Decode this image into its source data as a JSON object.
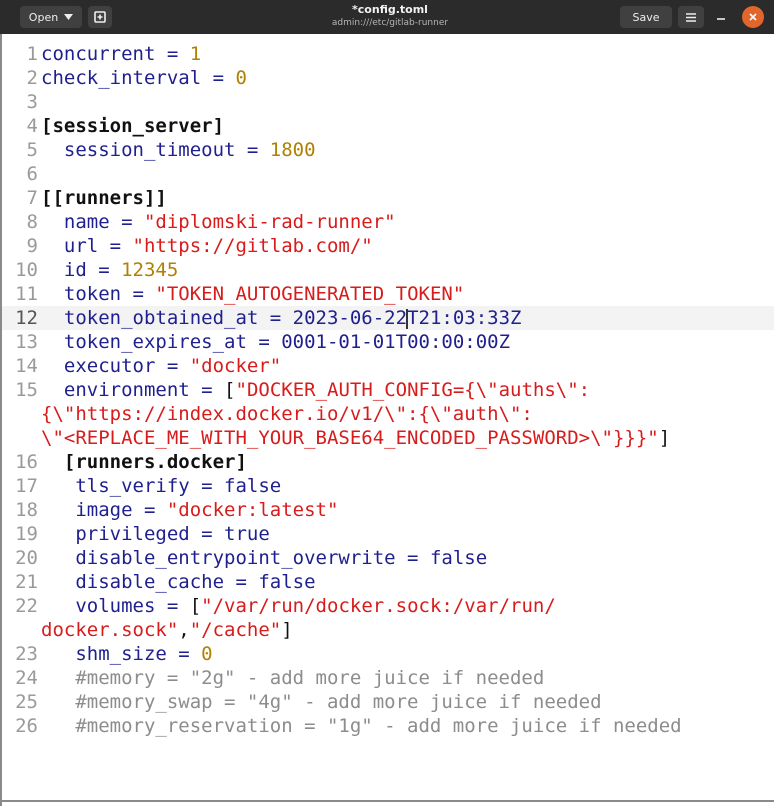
{
  "header": {
    "open_label": "Open",
    "title": "*config.toml",
    "subtitle": "admin:///etc/gitlab-runner",
    "save_label": "Save",
    "icons": [
      "chevron-down-icon",
      "new-document-icon",
      "hamburger-menu-icon",
      "minimize-icon",
      "close-icon"
    ],
    "accent_color": "#e0662c"
  },
  "editor": {
    "current_line": 12,
    "colors": {
      "key": "#1f1f8f",
      "number": "#b08000",
      "string": "#d81b1b",
      "comment": "#8c8c8c",
      "line_number": "#9a9a9a"
    },
    "lines": [
      {
        "n": "1",
        "k": "concurrent",
        "op": " = ",
        "v": "1"
      },
      {
        "n": "2",
        "k": "check_interval",
        "op": " = ",
        "v": "0"
      },
      {
        "n": "3"
      },
      {
        "n": "4",
        "sec": "[session_server]"
      },
      {
        "n": "5",
        "k": "  session_timeout",
        "op": " = ",
        "v": "1800"
      },
      {
        "n": "6"
      },
      {
        "n": "7",
        "sec": "[[runners]]"
      },
      {
        "n": "8",
        "k": "  name",
        "op": " = ",
        "v": "\"diplomski-rad-runner\""
      },
      {
        "n": "9",
        "k": "  url",
        "op": " = ",
        "v": "\"https://gitlab.com/\""
      },
      {
        "n": "10",
        "k": "  id",
        "op": " = ",
        "v": "12345"
      },
      {
        "n": "11",
        "k": "  token",
        "op": " = ",
        "v": "\"TOKEN_AUTOGENERATED_TOKEN\""
      },
      {
        "n": "12",
        "k": "  token_obtained_at",
        "op": " = ",
        "v1": "2023-06-22",
        "v2": "T21:03:33Z"
      },
      {
        "n": "13",
        "k": "  token_expires_at",
        "op": " = ",
        "v": "0001-01-01T00:00:00Z"
      },
      {
        "n": "14",
        "k": "  executor",
        "op": " = ",
        "v": "\"docker\""
      },
      {
        "n": "15",
        "k": "  environment",
        "op": " = ",
        "a": "[",
        "s1": "\"DOCKER_AUTH_CONFIG={\\\"auths\\\":",
        "s2": "{\\\"https://index.docker.io/v1/\\\":{\\\"auth\\\":",
        "s3": "\\\"<REPLACE_ME_WITH_YOUR_BASE64_ENCODED_PASSWORD>\\\"}}}\"",
        "z": "]"
      },
      {
        "n": "16",
        "sec": "  [runners.docker]"
      },
      {
        "n": "17",
        "k": "   tls_verify",
        "op": " = ",
        "v": "false"
      },
      {
        "n": "18",
        "k": "   image",
        "op": " = ",
        "v": "\"docker:latest\""
      },
      {
        "n": "19",
        "k": "   privileged",
        "op": " = ",
        "v": "true"
      },
      {
        "n": "20",
        "k": "   disable_entrypoint_overwrite",
        "op": " = ",
        "v": "false"
      },
      {
        "n": "21",
        "k": "   disable_cache",
        "op": " = ",
        "v": "false"
      },
      {
        "n": "22",
        "k": "   volumes",
        "op": " = ",
        "a": "[",
        "s1": "\"/var/run/docker.sock:/var/run/",
        "s2": "docker.sock\"",
        "c": ",",
        "s3": "\"/cache\"",
        "z": "]"
      },
      {
        "n": "23",
        "k": "   shm_size",
        "op": " = ",
        "v": "0"
      },
      {
        "n": "24",
        "cm": "   #memory = \"2g\" - add more juice if needed"
      },
      {
        "n": "25",
        "cm": "   #memory_swap = \"4g\" - add more juice if needed"
      },
      {
        "n": "26",
        "cm": "   #memory_reservation = \"1g\" - add more juice if needed"
      }
    ]
  }
}
